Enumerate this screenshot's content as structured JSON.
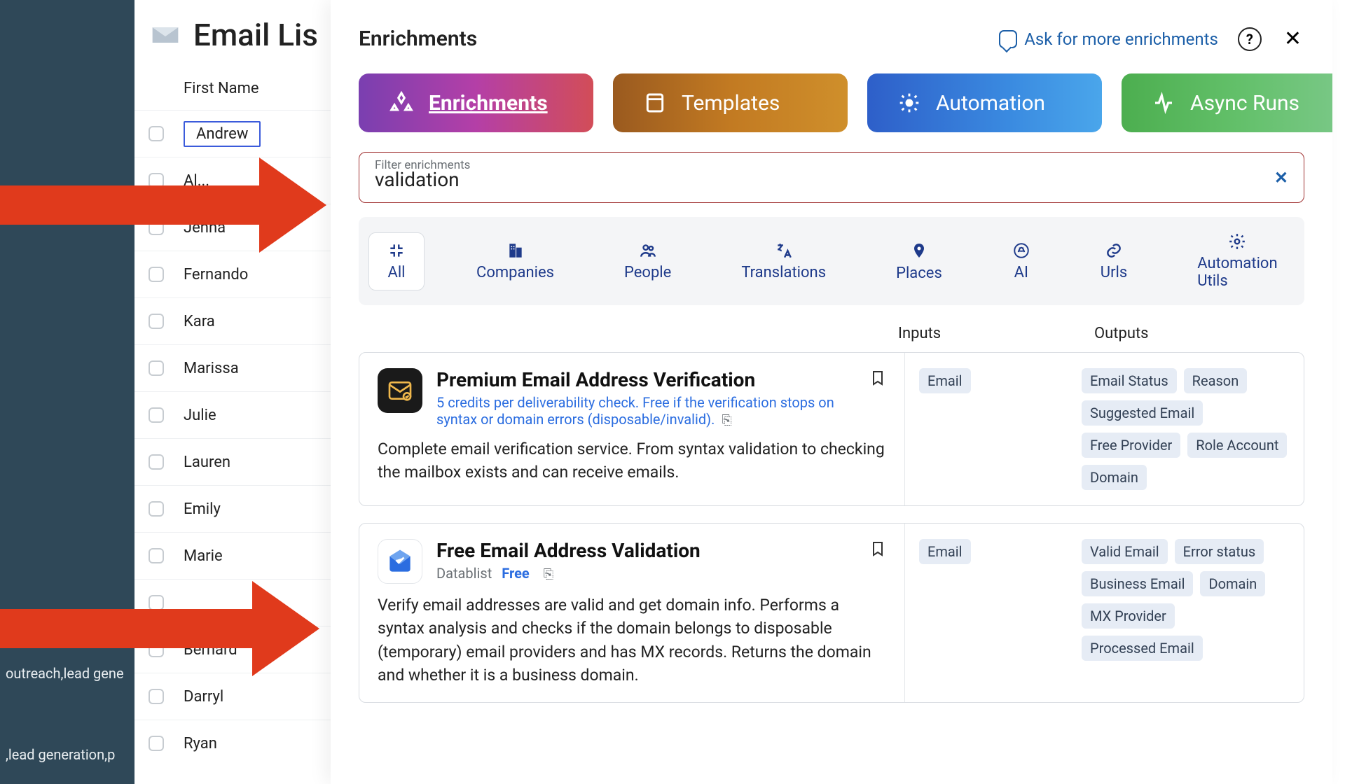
{
  "left_rail": {
    "tag_line_upper": "outreach,lead gene",
    "tag_line_lower": ",lead generation,p"
  },
  "list": {
    "title": "Email Lis",
    "column": "First Name",
    "rows": [
      "Andrew",
      "Al...",
      "Jenna",
      "Fernando",
      "Kara",
      "Marissa",
      "Julie",
      "Lauren",
      "Emily",
      "Marie",
      "",
      "Bernard",
      "Darryl",
      "Ryan"
    ]
  },
  "modal": {
    "title": "Enrichments",
    "ask": "Ask for more enrichments",
    "tabs": {
      "enrichments": "Enrichments",
      "templates": "Templates",
      "automation": "Automation",
      "async": "Async Runs"
    },
    "filter": {
      "label": "Filter enrichments",
      "value": "validation"
    },
    "categories": [
      "All",
      "Companies",
      "People",
      "Translations",
      "Places",
      "AI",
      "Urls",
      "Automation Utils"
    ],
    "io_headers": {
      "inputs": "Inputs",
      "outputs": "Outputs"
    },
    "cards": [
      {
        "title": "Premium Email Address Verification",
        "subtitle": "5 credits per deliverability check. Free if the verification stops on syntax or domain errors (disposable/invalid).",
        "desc": "Complete email verification service. From syntax validation to checking the mailbox exists and can receive emails.",
        "inputs": [
          "Email"
        ],
        "outputs": [
          "Email Status",
          "Reason",
          "Suggested Email",
          "Free Provider",
          "Role Account",
          "Domain"
        ]
      },
      {
        "title": "Free Email Address Validation",
        "provider": "Datablist",
        "free": "Free",
        "desc": "Verify email addresses are valid and get domain info. Performs a syntax analysis and checks if the domain belongs to disposable (temporary) email providers and has MX records. Returns the domain and whether it is a business domain.",
        "inputs": [
          "Email"
        ],
        "outputs": [
          "Valid Email",
          "Error status",
          "Business Email",
          "Domain",
          "MX Provider",
          "Processed Email"
        ]
      }
    ]
  }
}
